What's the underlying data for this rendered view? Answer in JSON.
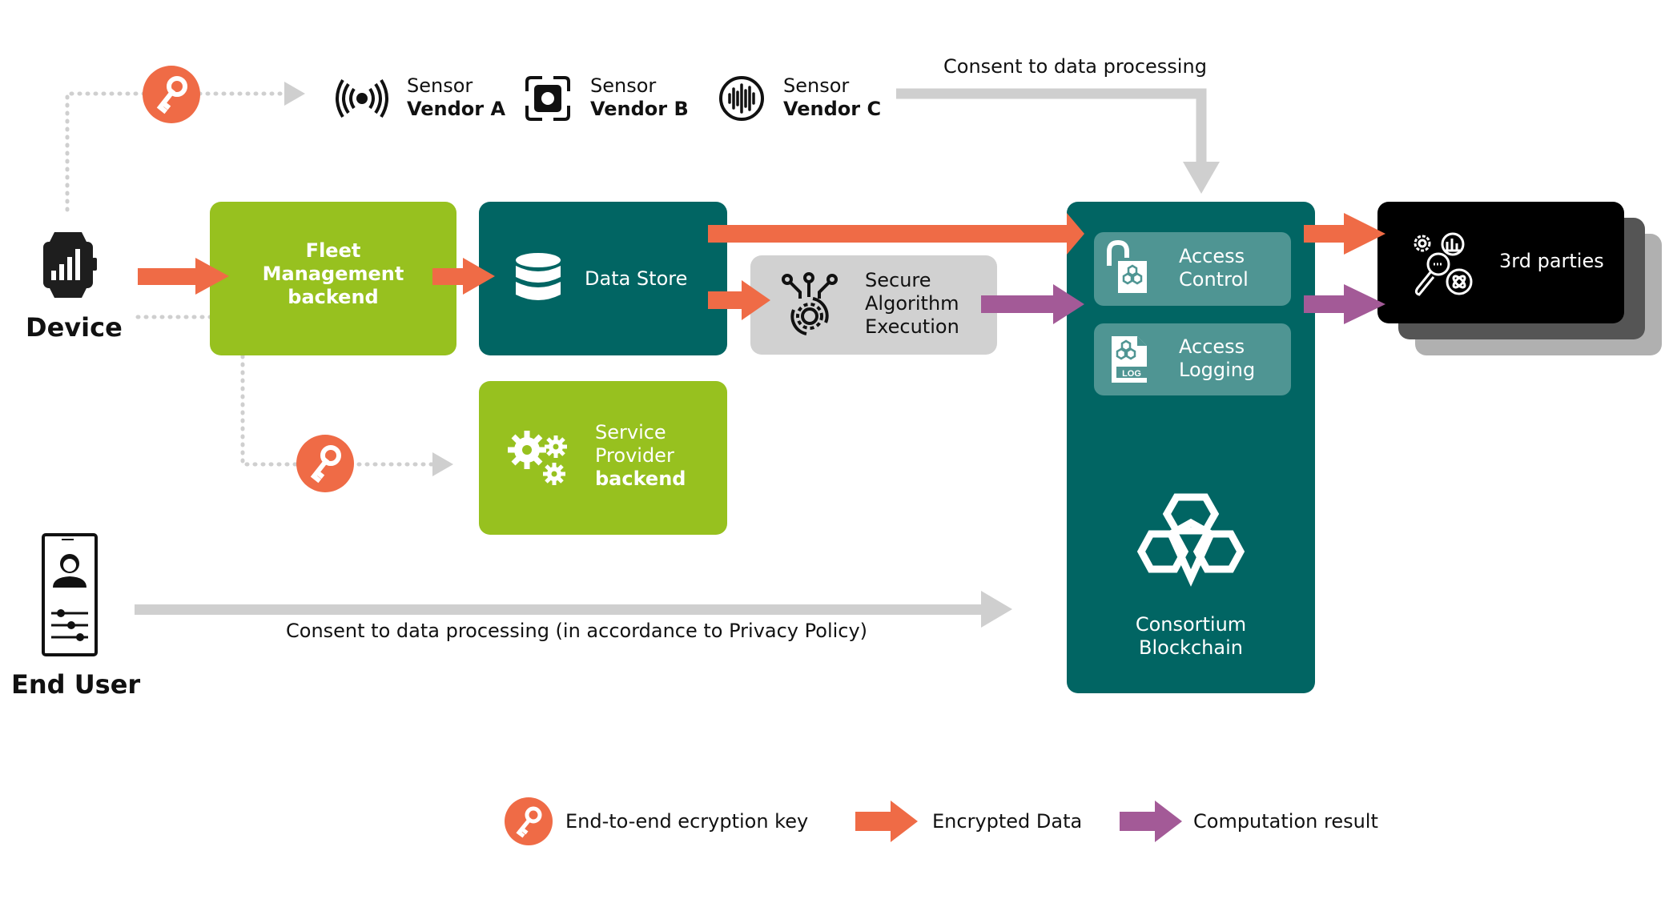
{
  "colors": {
    "encrypted": "#ef6b46",
    "computation": "#a35a97",
    "green": "#97c11f",
    "teal": "#016563",
    "teal_sub": "#4f9593",
    "grey": "#d1d1d1",
    "black": "#000000"
  },
  "actors": {
    "device": {
      "label": "Device",
      "icon": "smartwatch-icon"
    },
    "end_user": {
      "label": "End User",
      "icon": "mobile-user-settings-icon"
    }
  },
  "sensors": [
    {
      "line1": "Sensor",
      "line2": "Vendor A",
      "icon": "broadcast-signal-icon"
    },
    {
      "line1": "Sensor",
      "line2": "Vendor B",
      "icon": "chip-sensor-icon"
    },
    {
      "line1": "Sensor",
      "line2": "Vendor C",
      "icon": "sound-wave-icon"
    }
  ],
  "nodes": {
    "fleet": {
      "line1": "Fleet",
      "line2": "Management",
      "line3": "backend"
    },
    "datastore": {
      "label": "Data Store",
      "icon": "database-icon"
    },
    "secure_algo": {
      "line1": "Secure",
      "line2": "Algorithm",
      "line3": "Execution",
      "icon": "algorithm-gear-icon"
    },
    "service_provider": {
      "line1": "Service",
      "line2": "Provider",
      "line3": "backend",
      "icon": "gears-icon"
    },
    "blockchain": {
      "line1": "Consortium",
      "line2": "Blockchain",
      "icon": "blockchain-hexagons-icon",
      "access_control": {
        "line1": "Access",
        "line2": "Control",
        "icon": "unlocked-padlock-icon"
      },
      "access_logging": {
        "line1": "Access",
        "line2": "Logging",
        "icon": "log-file-icon",
        "icon_text": "LOG"
      }
    },
    "third_parties": {
      "label": "3rd parties",
      "icon": "data-analytics-icon"
    }
  },
  "edges": {
    "consent_top": "Consent to data processing",
    "consent_bottom": "Consent to data processing (in accordance to Privacy Policy)"
  },
  "legend": [
    {
      "label": "End-to-end ecryption key",
      "icon": "key-icon"
    },
    {
      "label": "Encrypted Data",
      "icon": "orange-arrow-icon"
    },
    {
      "label": "Computation result",
      "icon": "purple-arrow-icon"
    }
  ]
}
